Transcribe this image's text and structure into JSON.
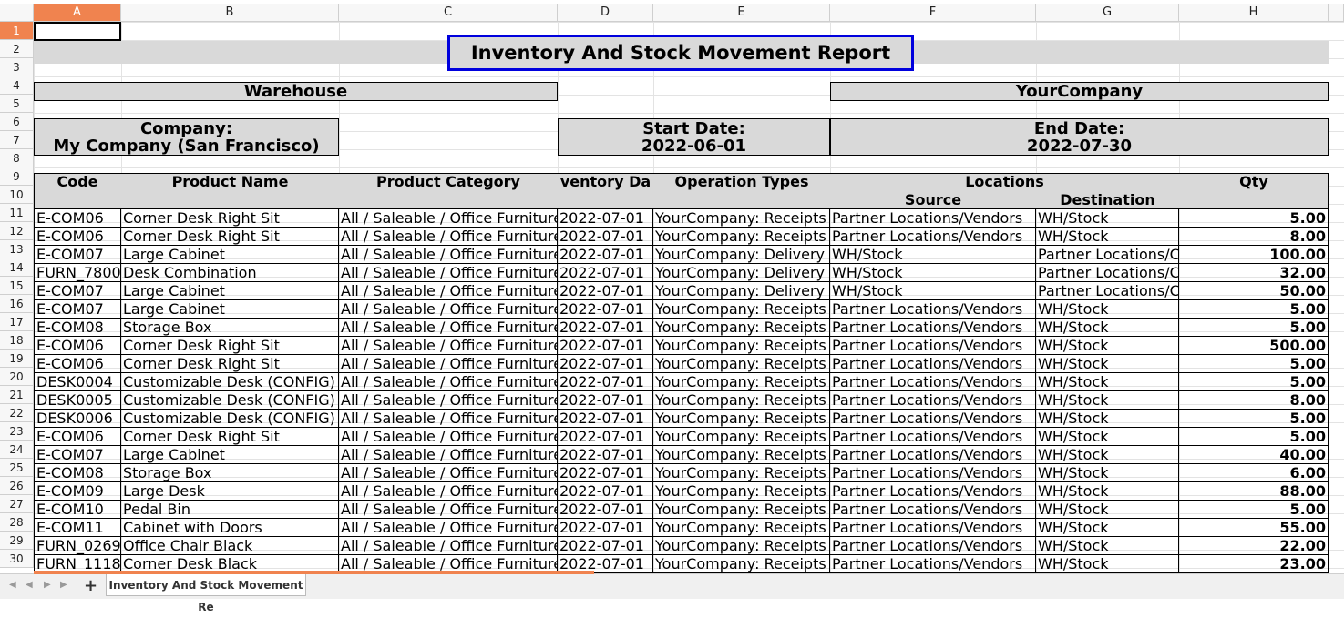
{
  "columns": [
    "A",
    "B",
    "C",
    "D",
    "E",
    "F",
    "G",
    "H"
  ],
  "rows": [
    "1",
    "2",
    "3",
    "4",
    "5",
    "6",
    "7",
    "8",
    "9",
    "10",
    "11",
    "12",
    "13",
    "14",
    "15",
    "16",
    "17",
    "18",
    "19",
    "20",
    "21",
    "22",
    "23",
    "24",
    "25",
    "26",
    "27",
    "28",
    "29",
    "30"
  ],
  "title": "Inventory And Stock Movement Report",
  "warehouse_label": "Warehouse",
  "warehouse_value": "YourCompany",
  "company_label": "Company:",
  "company_value": "My Company (San Francisco)",
  "start_label": "Start Date:",
  "start_value": "2022-06-01",
  "end_label": "End Date:",
  "end_value": "2022-07-30",
  "headers": {
    "code": "Code",
    "product": "Product Name",
    "category": "Product Category",
    "date": "ventory Da",
    "operation": "Operation Types",
    "locations": "Locations",
    "source": "Source",
    "destination": "Destination",
    "qty": "Qty"
  },
  "data_rows": [
    {
      "code": "E-COM06",
      "product": "Corner Desk Right Sit",
      "category": "All / Saleable / Office Furniture",
      "date": "2022-07-01",
      "operation": "YourCompany: Receipts",
      "source": "Partner Locations/Vendors",
      "dest": "WH/Stock",
      "qty": "5.00"
    },
    {
      "code": "E-COM06",
      "product": "Corner Desk Right Sit",
      "category": "All / Saleable / Office Furniture",
      "date": "2022-07-01",
      "operation": "YourCompany: Receipts",
      "source": "Partner Locations/Vendors",
      "dest": "WH/Stock",
      "qty": "8.00"
    },
    {
      "code": "E-COM07",
      "product": "Large Cabinet",
      "category": "All / Saleable / Office Furniture",
      "date": "2022-07-01",
      "operation": "YourCompany: Delivery",
      "source": "WH/Stock",
      "dest": "Partner Locations/C",
      "qty": "100.00"
    },
    {
      "code": "FURN_7800",
      "product": "Desk Combination",
      "category": "All / Saleable / Office Furniture",
      "date": "2022-07-01",
      "operation": "YourCompany: Delivery",
      "source": "WH/Stock",
      "dest": "Partner Locations/C",
      "qty": "32.00"
    },
    {
      "code": "E-COM07",
      "product": "Large Cabinet",
      "category": "All / Saleable / Office Furniture",
      "date": "2022-07-01",
      "operation": "YourCompany: Delivery",
      "source": "WH/Stock",
      "dest": "Partner Locations/C",
      "qty": "50.00"
    },
    {
      "code": "E-COM07",
      "product": "Large Cabinet",
      "category": "All / Saleable / Office Furniture",
      "date": "2022-07-01",
      "operation": "YourCompany: Receipts",
      "source": "Partner Locations/Vendors",
      "dest": "WH/Stock",
      "qty": "5.00"
    },
    {
      "code": "E-COM08",
      "product": "Storage Box",
      "category": "All / Saleable / Office Furniture",
      "date": "2022-07-01",
      "operation": "YourCompany: Receipts",
      "source": "Partner Locations/Vendors",
      "dest": "WH/Stock",
      "qty": "5.00"
    },
    {
      "code": "E-COM06",
      "product": "Corner Desk Right Sit",
      "category": "All / Saleable / Office Furniture",
      "date": "2022-07-01",
      "operation": "YourCompany: Receipts",
      "source": "Partner Locations/Vendors",
      "dest": "WH/Stock",
      "qty": "500.00"
    },
    {
      "code": "E-COM06",
      "product": "Corner Desk Right Sit",
      "category": "All / Saleable / Office Furniture",
      "date": "2022-07-01",
      "operation": "YourCompany: Receipts",
      "source": "Partner Locations/Vendors",
      "dest": "WH/Stock",
      "qty": "5.00"
    },
    {
      "code": "DESK0004",
      "product": "Customizable Desk (CONFIG)",
      "category": "All / Saleable / Office Furniture",
      "date": "2022-07-01",
      "operation": "YourCompany: Receipts",
      "source": "Partner Locations/Vendors",
      "dest": "WH/Stock",
      "qty": "5.00"
    },
    {
      "code": "DESK0005",
      "product": "Customizable Desk (CONFIG)",
      "category": "All / Saleable / Office Furniture",
      "date": "2022-07-01",
      "operation": "YourCompany: Receipts",
      "source": "Partner Locations/Vendors",
      "dest": "WH/Stock",
      "qty": "8.00"
    },
    {
      "code": "DESK0006",
      "product": "Customizable Desk (CONFIG)",
      "category": "All / Saleable / Office Furniture",
      "date": "2022-07-01",
      "operation": "YourCompany: Receipts",
      "source": "Partner Locations/Vendors",
      "dest": "WH/Stock",
      "qty": "5.00"
    },
    {
      "code": "E-COM06",
      "product": "Corner Desk Right Sit",
      "category": "All / Saleable / Office Furniture",
      "date": "2022-07-01",
      "operation": "YourCompany: Receipts",
      "source": "Partner Locations/Vendors",
      "dest": "WH/Stock",
      "qty": "5.00"
    },
    {
      "code": "E-COM07",
      "product": "Large Cabinet",
      "category": "All / Saleable / Office Furniture",
      "date": "2022-07-01",
      "operation": "YourCompany: Receipts",
      "source": "Partner Locations/Vendors",
      "dest": "WH/Stock",
      "qty": "40.00"
    },
    {
      "code": "E-COM08",
      "product": "Storage Box",
      "category": "All / Saleable / Office Furniture",
      "date": "2022-07-01",
      "operation": "YourCompany: Receipts",
      "source": "Partner Locations/Vendors",
      "dest": "WH/Stock",
      "qty": "6.00"
    },
    {
      "code": "E-COM09",
      "product": "Large Desk",
      "category": "All / Saleable / Office Furniture",
      "date": "2022-07-01",
      "operation": "YourCompany: Receipts",
      "source": "Partner Locations/Vendors",
      "dest": "WH/Stock",
      "qty": "88.00"
    },
    {
      "code": "E-COM10",
      "product": "Pedal Bin",
      "category": "All / Saleable / Office Furniture",
      "date": "2022-07-01",
      "operation": "YourCompany: Receipts",
      "source": "Partner Locations/Vendors",
      "dest": "WH/Stock",
      "qty": "5.00"
    },
    {
      "code": "E-COM11",
      "product": "Cabinet with Doors",
      "category": "All / Saleable / Office Furniture",
      "date": "2022-07-01",
      "operation": "YourCompany: Receipts",
      "source": "Partner Locations/Vendors",
      "dest": "WH/Stock",
      "qty": "55.00"
    },
    {
      "code": "FURN_0269",
      "product": "Office Chair Black",
      "category": "All / Saleable / Office Furniture",
      "date": "2022-07-01",
      "operation": "YourCompany: Receipts",
      "source": "Partner Locations/Vendors",
      "dest": "WH/Stock",
      "qty": "22.00"
    },
    {
      "code": "FURN_1118",
      "product": "Corner Desk Black",
      "category": "All / Saleable / Office Furniture",
      "date": "2022-07-01",
      "operation": "YourCompany: Receipts",
      "source": "Partner Locations/Vendors",
      "dest": "WH/Stock",
      "qty": "23.00"
    }
  ],
  "sheet_tab": "Inventory And Stock Movement Re",
  "add_sheet_symbol": "+",
  "colors": {
    "accent": "#f0834f",
    "band": "#d9d9d9",
    "title_border": "#0000dd"
  }
}
